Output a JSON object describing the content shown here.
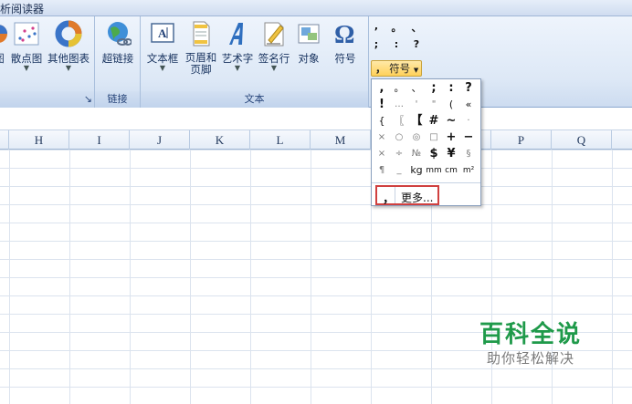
{
  "titlebar": {
    "text": "析阅读器"
  },
  "ribbon": {
    "buttons": [
      {
        "label": "图",
        "icon": "chart-icon"
      },
      {
        "label": "散点图",
        "icon": "scatter-chart-icon"
      },
      {
        "label": "其他图表",
        "icon": "donut-chart-icon"
      },
      {
        "label": "超链接",
        "icon": "hyperlink-globe-icon"
      },
      {
        "label": "文本框",
        "icon": "textbox-icon"
      },
      {
        "label": "页眉和",
        "label2": "页脚",
        "icon": "header-footer-icon"
      },
      {
        "label": "艺术字",
        "icon": "wordart-icon"
      },
      {
        "label": "签名行",
        "icon": "signature-line-icon"
      },
      {
        "label": "对象",
        "icon": "object-icon"
      },
      {
        "label": "符号",
        "icon": "omega-symbol-icon"
      }
    ],
    "groups": {
      "links": "链接",
      "text": "文本"
    },
    "gallery_symbols": [
      ",",
      "。",
      "、",
      ";",
      ":",
      "?"
    ],
    "symbol_button": {
      "glyph": "，",
      "label": "符号"
    }
  },
  "columns": [
    "H",
    "I",
    "J",
    "K",
    "L",
    "M",
    "P",
    "Q"
  ],
  "dropdown": {
    "rows": [
      [
        ",",
        "。",
        "、",
        ";",
        ":",
        "?"
      ],
      [
        "!",
        "…",
        "'",
        "\"",
        "(",
        "«"
      ],
      [
        "{",
        "〖",
        "【",
        "#",
        "~",
        "·"
      ],
      [
        "×",
        "○",
        "◎",
        "□",
        "+",
        "−"
      ],
      [
        "×",
        "÷",
        "№",
        "$",
        "¥",
        "§"
      ],
      [
        "¶",
        "_",
        "kg",
        "mm",
        "cm",
        "m²"
      ]
    ],
    "more": {
      "glyph": "，",
      "label": "更多..."
    }
  },
  "watermark": {
    "title": "百科全说",
    "subtitle": "助你轻松解决"
  }
}
